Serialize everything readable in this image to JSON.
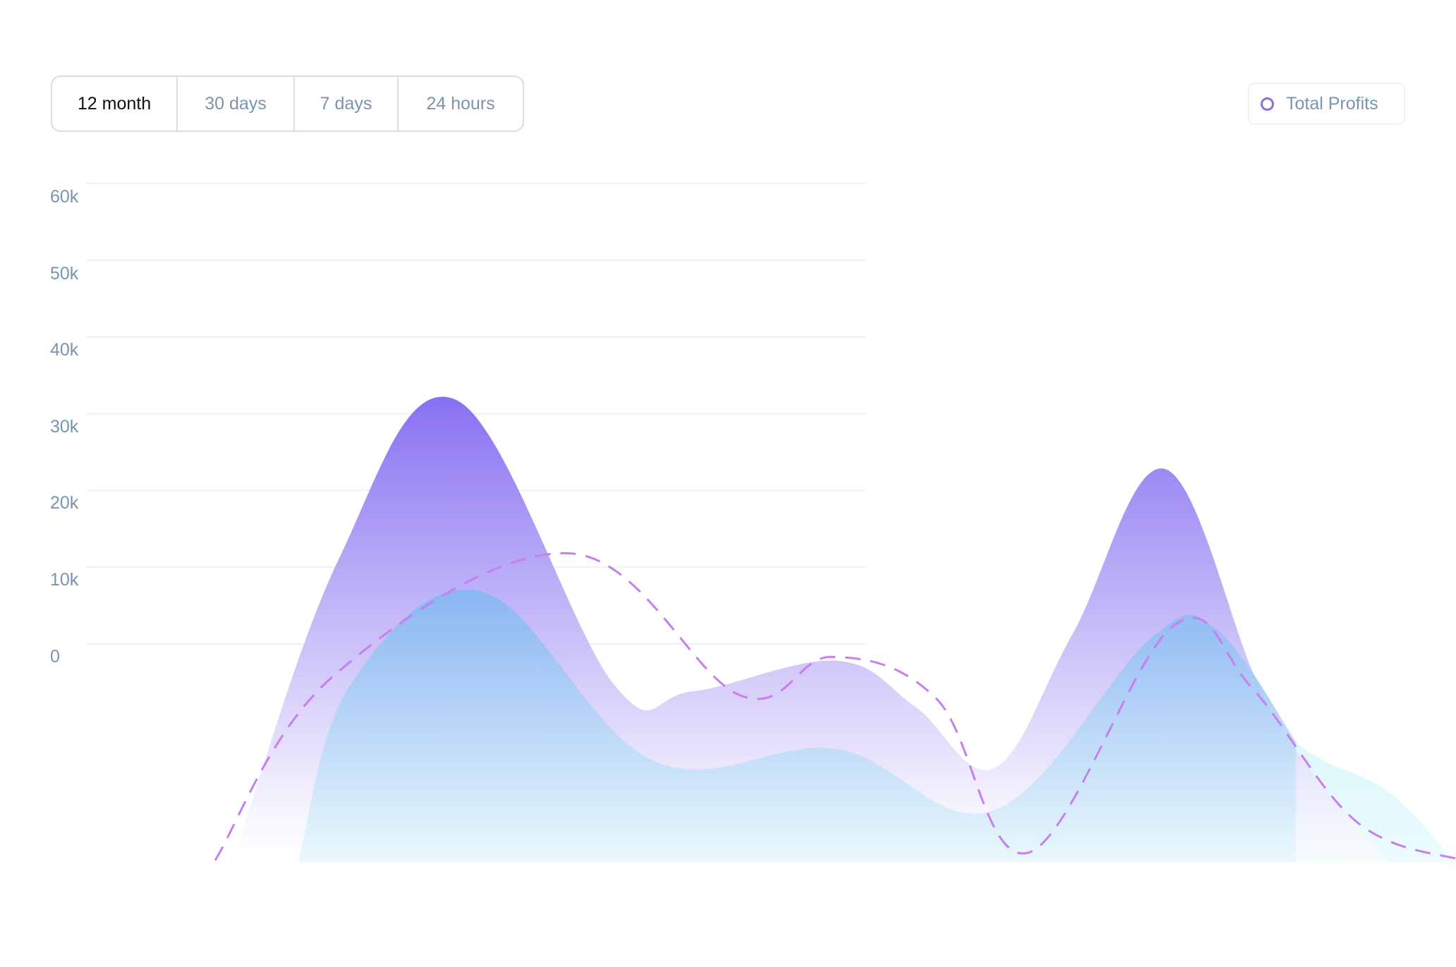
{
  "range_tabs": {
    "items": [
      {
        "label": "12 month",
        "active": true
      },
      {
        "label": "30 days",
        "active": false
      },
      {
        "label": "7 days",
        "active": false
      },
      {
        "label": "24 hours",
        "active": false
      }
    ]
  },
  "legend": {
    "label": "Total Profits",
    "color": "#8a6cf0"
  },
  "colors": {
    "purple_series": "#8a72f2",
    "blue_series": "#8cbcf2",
    "cyan_series": "#cdf4fb",
    "dashed_line": "#c67ef0",
    "axis_text": "#7a94b0",
    "gridline": "#eef1f5"
  },
  "chart_data": {
    "type": "area",
    "y_ticks": [
      "60k",
      "50k",
      "40k",
      "30k",
      "20k",
      "10k",
      "0"
    ],
    "ylim": [
      0,
      60000
    ],
    "grid": true,
    "legend_position": "top-right",
    "series": [
      {
        "name": "Total Profits",
        "style": "dashed-line",
        "x": [
          0.05,
          0.14,
          0.32,
          0.45,
          0.52,
          0.6,
          0.67,
          0.78,
          0.84,
          0.92,
          1.0
        ],
        "values": [
          -28000,
          -4000,
          12000,
          -6500,
          -1500,
          -7000,
          -27000,
          2500,
          -5500,
          -23000,
          -28000
        ]
      },
      {
        "style": "area",
        "x": [
          0.07,
          0.15,
          0.24,
          0.36,
          0.42,
          0.53,
          0.59,
          0.65,
          0.71,
          0.78,
          0.85,
          0.89,
          0.95
        ],
        "values": [
          -28000,
          11000,
          32000,
          -5000,
          -6000,
          -2000,
          -8000,
          -16000,
          1500,
          23000,
          -4500,
          -16000,
          -28000
        ]
      },
      {
        "style": "area",
        "x": [
          0.12,
          0.16,
          0.26,
          0.39,
          0.53,
          0.65,
          0.77,
          0.82,
          0.88,
          0.95,
          1.0
        ],
        "values": [
          -28000,
          -5000,
          7000,
          -15000,
          -13500,
          -21500,
          1000,
          2000,
          -12500,
          -19000,
          -28000
        ]
      }
    ]
  }
}
